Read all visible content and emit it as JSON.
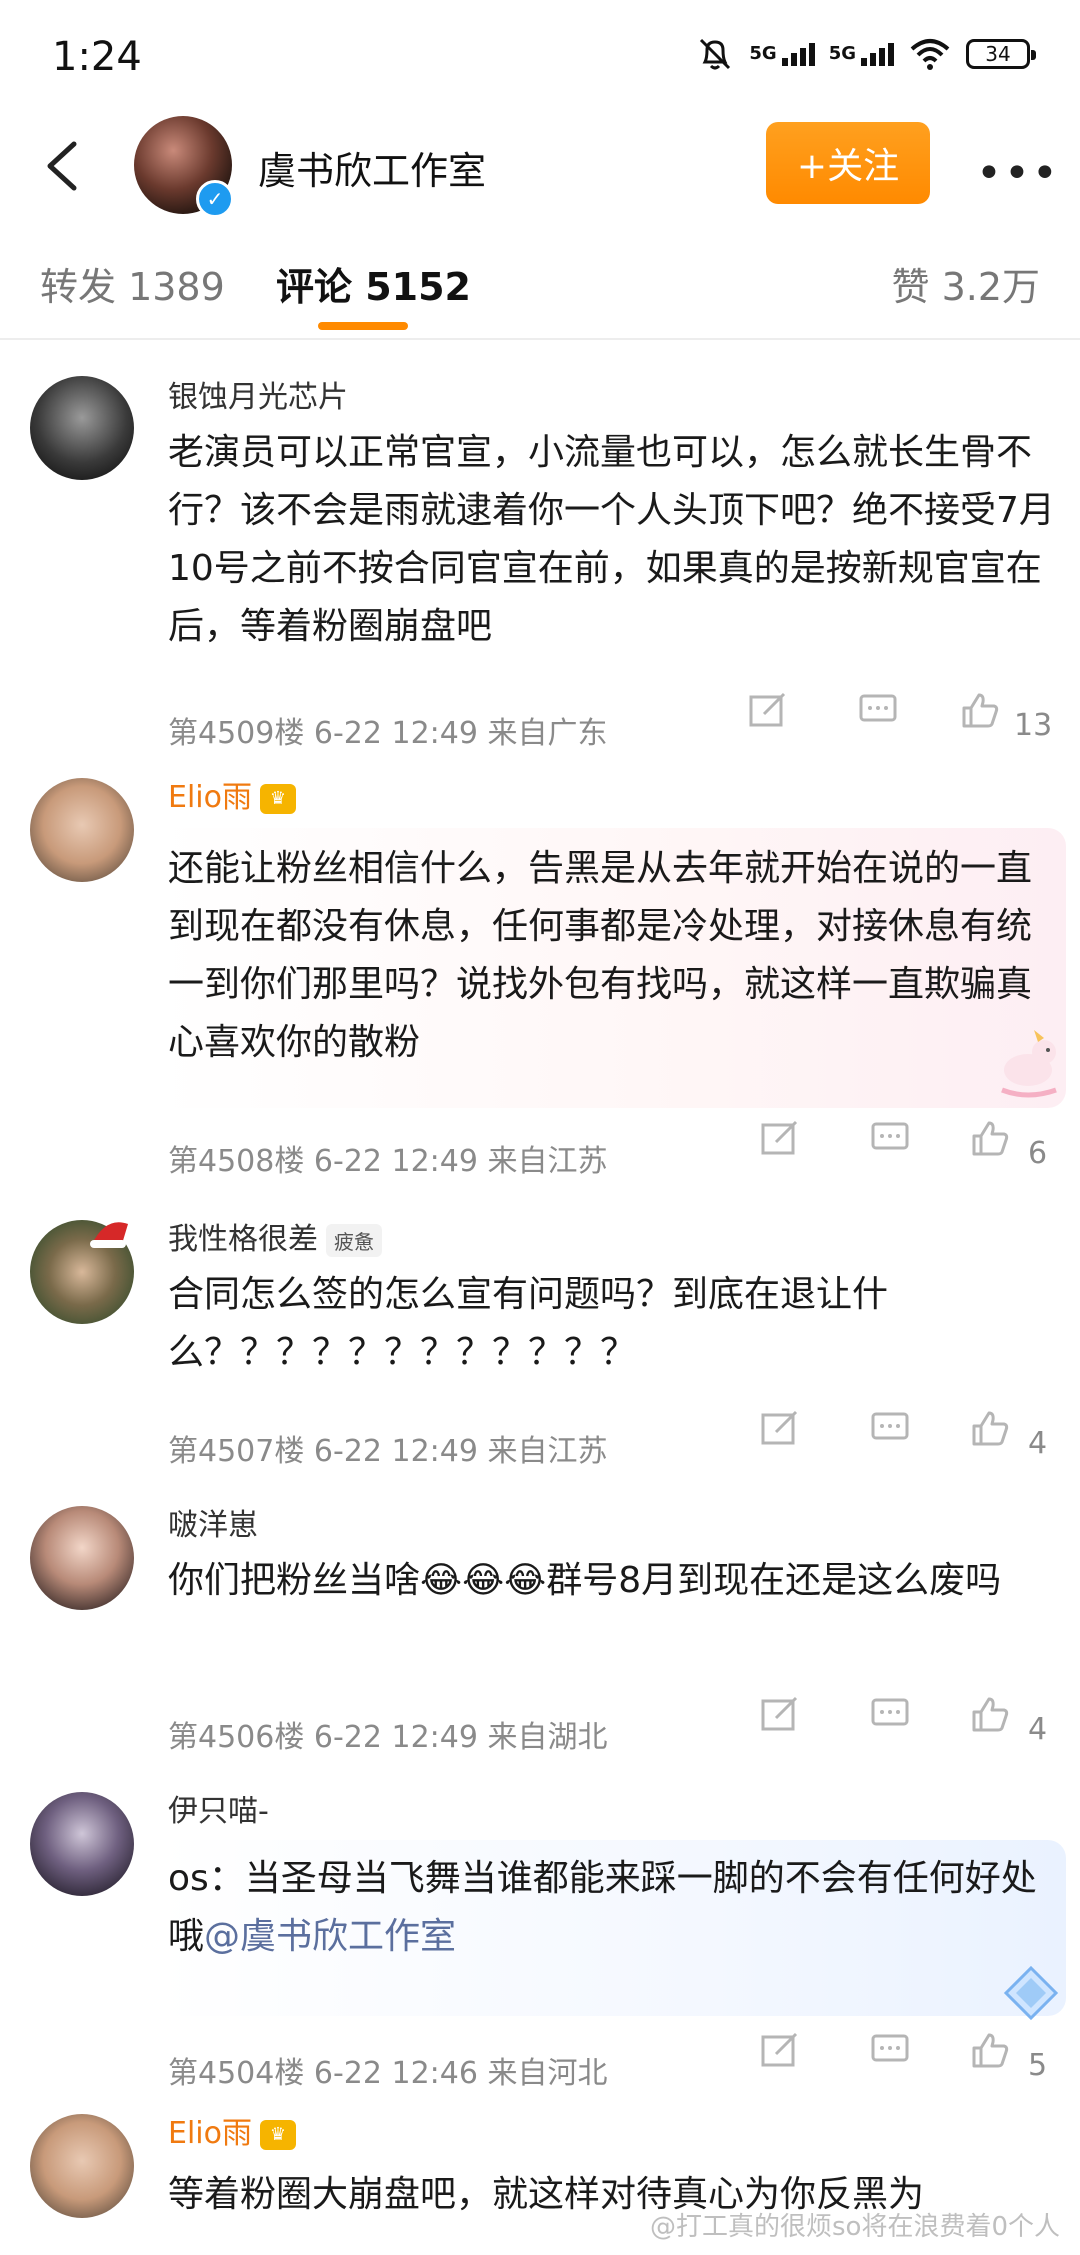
{
  "status": {
    "time": "1:24",
    "battery": "34",
    "net1": "5G",
    "net2": "5G",
    "wifi_sub": "6"
  },
  "header": {
    "title": "虞书欣工作室",
    "follow_label": "+关注",
    "more_label": "•••"
  },
  "tabs": {
    "repost": "转发 1389",
    "comment": "评论 5152",
    "like": "赞 3.2万"
  },
  "comments": [
    {
      "user": "银蚀月光芯片",
      "text": "老演员可以正常官宣，小流量也可以，怎么就长生骨不行？该不会是雨就逮着你一个人头顶下吧？绝不接受7月10号之前不按合同官宣在前，如果真的是按新规官宣在后，等着粉圈崩盘吧",
      "meta": "第4509楼  6-22 12:49  来自广东",
      "likes": "13"
    },
    {
      "user": "Elio雨",
      "text": "还能让粉丝相信什么，告黑是从去年就开始在说的一直到现在都没有休息，任何事都是冷处理，对接休息有统一到你们那里吗？说找外包有找吗，就这样一直欺骗真心喜欢你的散粉",
      "meta": "第4508楼  6-22 12:49  来自江苏",
      "likes": "6"
    },
    {
      "user": "我性格很差",
      "tag": "疲惫",
      "text": "合同怎么签的怎么宣有问题吗？到底在退让什么？？？？？？？？？？？？",
      "meta": "第4507楼  6-22 12:49  来自江苏",
      "likes": "4"
    },
    {
      "user": "啵洋崽",
      "text": "你们把粉丝当啥😂😂😂群号8月到现在还是这么废吗",
      "meta": "第4506楼  6-22 12:49  来自湖北",
      "likes": "4"
    },
    {
      "user": "伊只喵-",
      "text_a": "os：当圣母当飞舞当谁都能来踩一脚的不会有任何好处哦",
      "mention": "@虞书欣工作室",
      "meta": "第4504楼  6-22 12:46  来自河北",
      "likes": "5"
    },
    {
      "user": "Elio雨",
      "text": "等着粉圈大崩盘吧，就这样对待真心为你反黑为"
    }
  ],
  "watermark": "@打工真的很烦so将在浪费着0个人",
  "colors": {
    "accent": "#ff8a00",
    "vip_name": "#f07a10",
    "meta": "#8a8a8a"
  }
}
